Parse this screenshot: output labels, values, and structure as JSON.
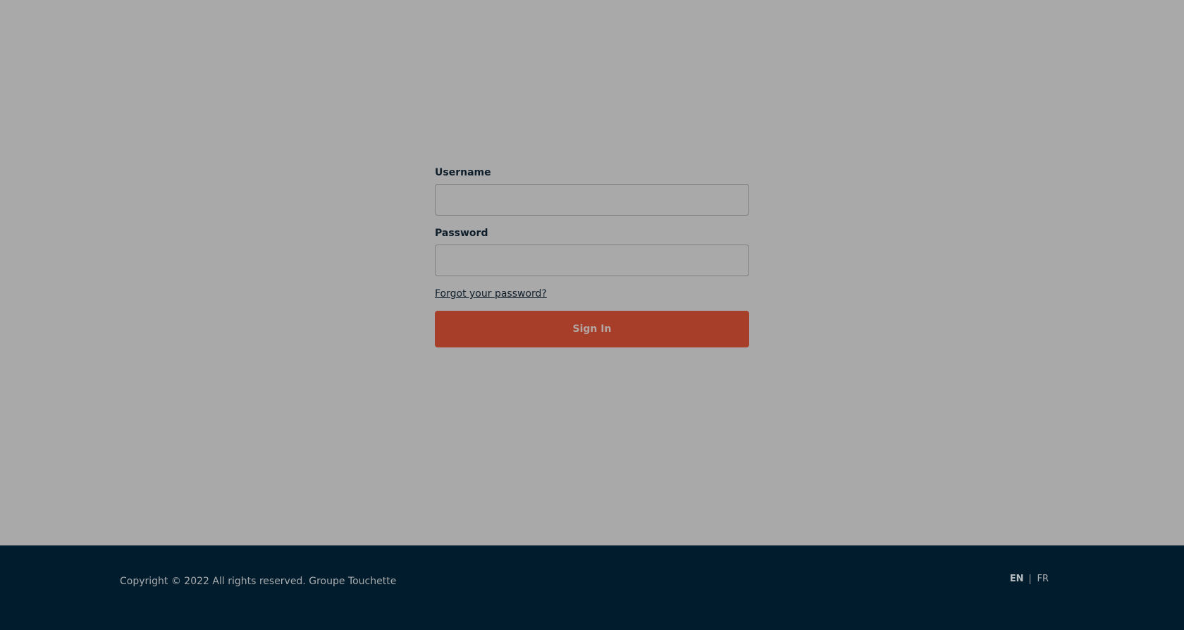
{
  "login_form": {
    "username_label": "Username",
    "username_value": "",
    "password_label": "Password",
    "password_value": "",
    "forgot_password_link": "Forgot your password?",
    "sign_in_button": "Sign In"
  },
  "footer": {
    "copyright": "Copyright © 2022 All rights reserved. Groupe Touchette",
    "languages": {
      "en": "EN",
      "fr": "FR",
      "selected": "EN"
    }
  },
  "colors": {
    "background": "#a9a9a9",
    "footer_background": "#011c2c",
    "primary_button": "#a63e2a",
    "label_text": "#0f1e2b"
  }
}
